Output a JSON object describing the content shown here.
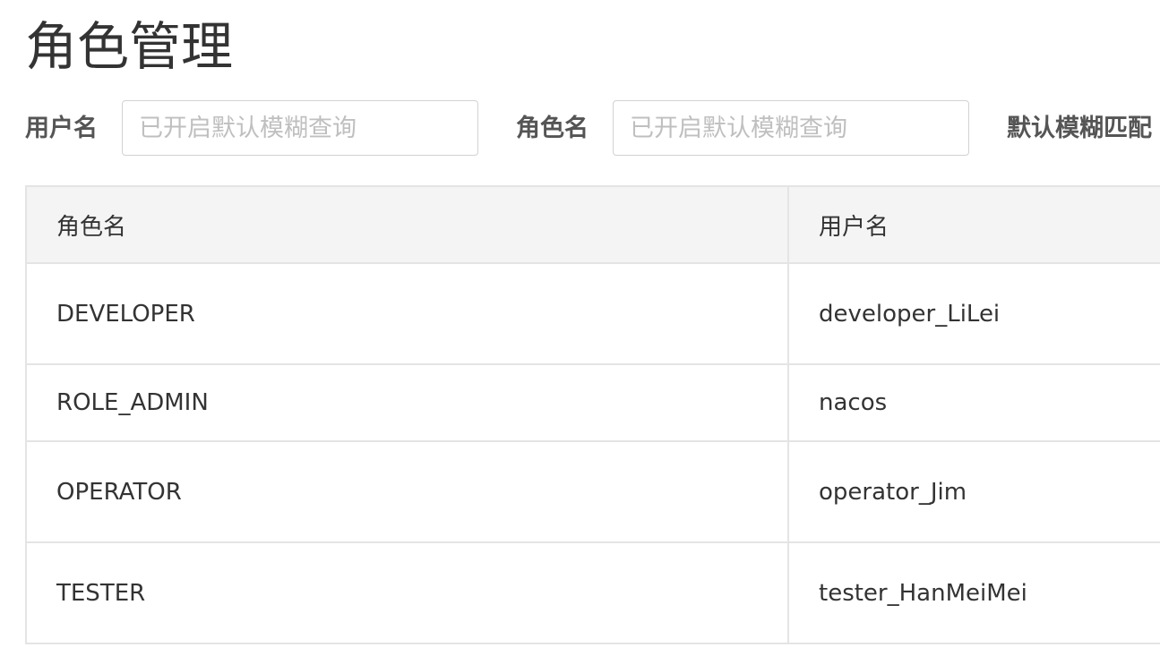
{
  "page": {
    "title": "角色管理"
  },
  "filters": {
    "username_label": "用户名",
    "username_placeholder": "已开启默认模糊查询",
    "username_value": "",
    "role_label": "角色名",
    "role_placeholder": "已开启默认模糊查询",
    "role_value": "",
    "fuzzy_label": "默认模糊匹配"
  },
  "table": {
    "columns": [
      "角色名",
      "用户名"
    ],
    "rows": [
      {
        "role": "DEVELOPER",
        "username": "developer_LiLei"
      },
      {
        "role": "ROLE_ADMIN",
        "username": "nacos"
      },
      {
        "role": "OPERATOR",
        "username": "operator_Jim"
      },
      {
        "role": "TESTER",
        "username": "tester_HanMeiMei"
      }
    ]
  },
  "colors": {
    "header_bg": "#f4f4f4",
    "border": "#e4e4e4",
    "text": "#333333",
    "label": "#555555",
    "placeholder": "#bfbfbf"
  }
}
